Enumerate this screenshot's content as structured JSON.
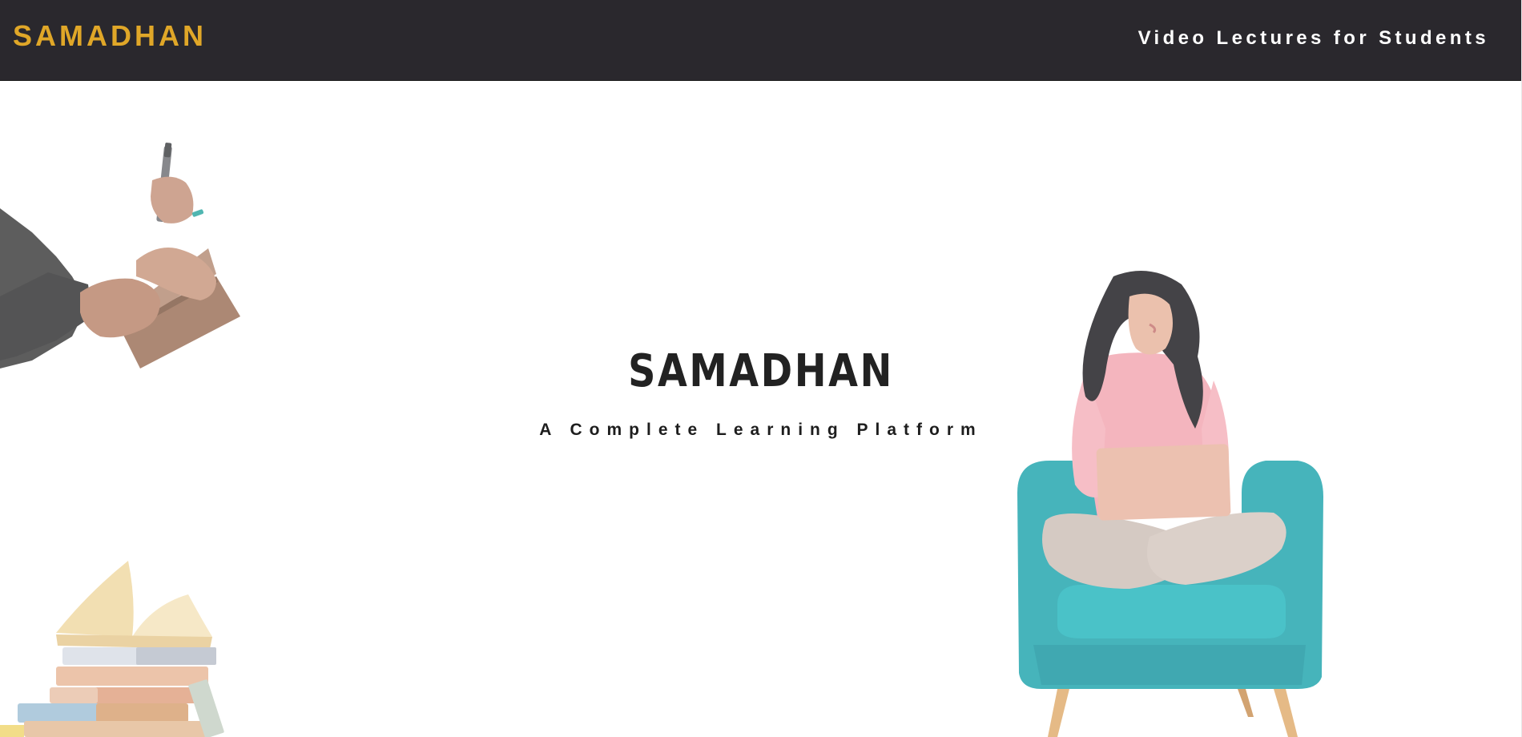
{
  "navbar": {
    "brand": "SAMADHAN",
    "link": "Video Lectures for Students"
  },
  "hero": {
    "title": "SAMADHAN",
    "subtitle": "A Complete Learning Platform"
  },
  "colors": {
    "navbar_bg": "#2a282d",
    "brand": "#e0a728",
    "nav_link": "#ffffff",
    "hero_text": "#222222"
  },
  "illustrations": [
    "hands-writing-notebook-image",
    "book-stack-image",
    "student-on-armchair-with-tablet-image"
  ]
}
